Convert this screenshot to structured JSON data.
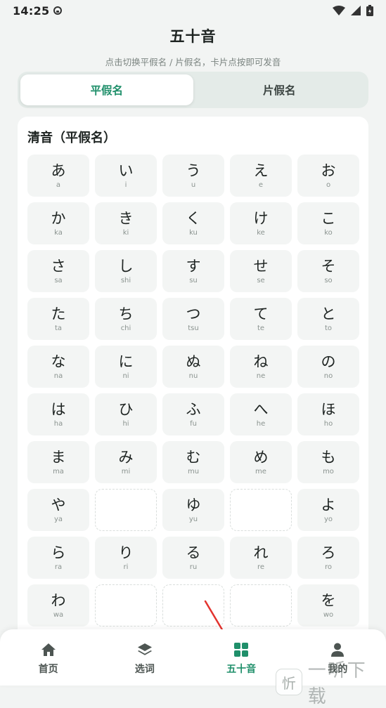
{
  "status_bar": {
    "time": "14:25"
  },
  "header": {
    "title": "五十音",
    "subtitle": "点击切换平假名 / 片假名，卡片点按即可发音"
  },
  "tabs": [
    {
      "label": "平假名",
      "active": true
    },
    {
      "label": "片假名",
      "active": false
    }
  ],
  "section": {
    "title": "清音（平假名）"
  },
  "kana": [
    {
      "char": "あ",
      "romaji": "a"
    },
    {
      "char": "い",
      "romaji": "i"
    },
    {
      "char": "う",
      "romaji": "u"
    },
    {
      "char": "え",
      "romaji": "e"
    },
    {
      "char": "お",
      "romaji": "o"
    },
    {
      "char": "か",
      "romaji": "ka"
    },
    {
      "char": "き",
      "romaji": "ki"
    },
    {
      "char": "く",
      "romaji": "ku"
    },
    {
      "char": "け",
      "romaji": "ke"
    },
    {
      "char": "こ",
      "romaji": "ko"
    },
    {
      "char": "さ",
      "romaji": "sa"
    },
    {
      "char": "し",
      "romaji": "shi"
    },
    {
      "char": "す",
      "romaji": "su"
    },
    {
      "char": "せ",
      "romaji": "se"
    },
    {
      "char": "そ",
      "romaji": "so"
    },
    {
      "char": "た",
      "romaji": "ta"
    },
    {
      "char": "ち",
      "romaji": "chi"
    },
    {
      "char": "つ",
      "romaji": "tsu"
    },
    {
      "char": "て",
      "romaji": "te"
    },
    {
      "char": "と",
      "romaji": "to"
    },
    {
      "char": "な",
      "romaji": "na"
    },
    {
      "char": "に",
      "romaji": "ni"
    },
    {
      "char": "ぬ",
      "romaji": "nu"
    },
    {
      "char": "ね",
      "romaji": "ne"
    },
    {
      "char": "の",
      "romaji": "no"
    },
    {
      "char": "は",
      "romaji": "ha"
    },
    {
      "char": "ひ",
      "romaji": "hi"
    },
    {
      "char": "ふ",
      "romaji": "fu"
    },
    {
      "char": "へ",
      "romaji": "he"
    },
    {
      "char": "ほ",
      "romaji": "ho"
    },
    {
      "char": "ま",
      "romaji": "ma"
    },
    {
      "char": "み",
      "romaji": "mi"
    },
    {
      "char": "む",
      "romaji": "mu"
    },
    {
      "char": "め",
      "romaji": "me"
    },
    {
      "char": "も",
      "romaji": "mo"
    },
    {
      "char": "や",
      "romaji": "ya"
    },
    null,
    {
      "char": "ゆ",
      "romaji": "yu"
    },
    null,
    {
      "char": "よ",
      "romaji": "yo"
    },
    {
      "char": "ら",
      "romaji": "ra"
    },
    {
      "char": "り",
      "romaji": "ri"
    },
    {
      "char": "る",
      "romaji": "ru"
    },
    {
      "char": "れ",
      "romaji": "re"
    },
    {
      "char": "ろ",
      "romaji": "ro"
    },
    {
      "char": "わ",
      "romaji": "wa"
    },
    null,
    null,
    null,
    {
      "char": "を",
      "romaji": "wo"
    }
  ],
  "bottom_nav": [
    {
      "label": "首页",
      "icon": "home-icon",
      "active": false
    },
    {
      "label": "选词",
      "icon": "layers-icon",
      "active": false
    },
    {
      "label": "五十音",
      "icon": "grid-icon",
      "active": true
    },
    {
      "label": "我的",
      "icon": "user-icon",
      "active": false
    }
  ],
  "watermark": {
    "text": "一听下载"
  },
  "colors": {
    "accent": "#1f8f6a",
    "arrow": "#e3342f"
  }
}
